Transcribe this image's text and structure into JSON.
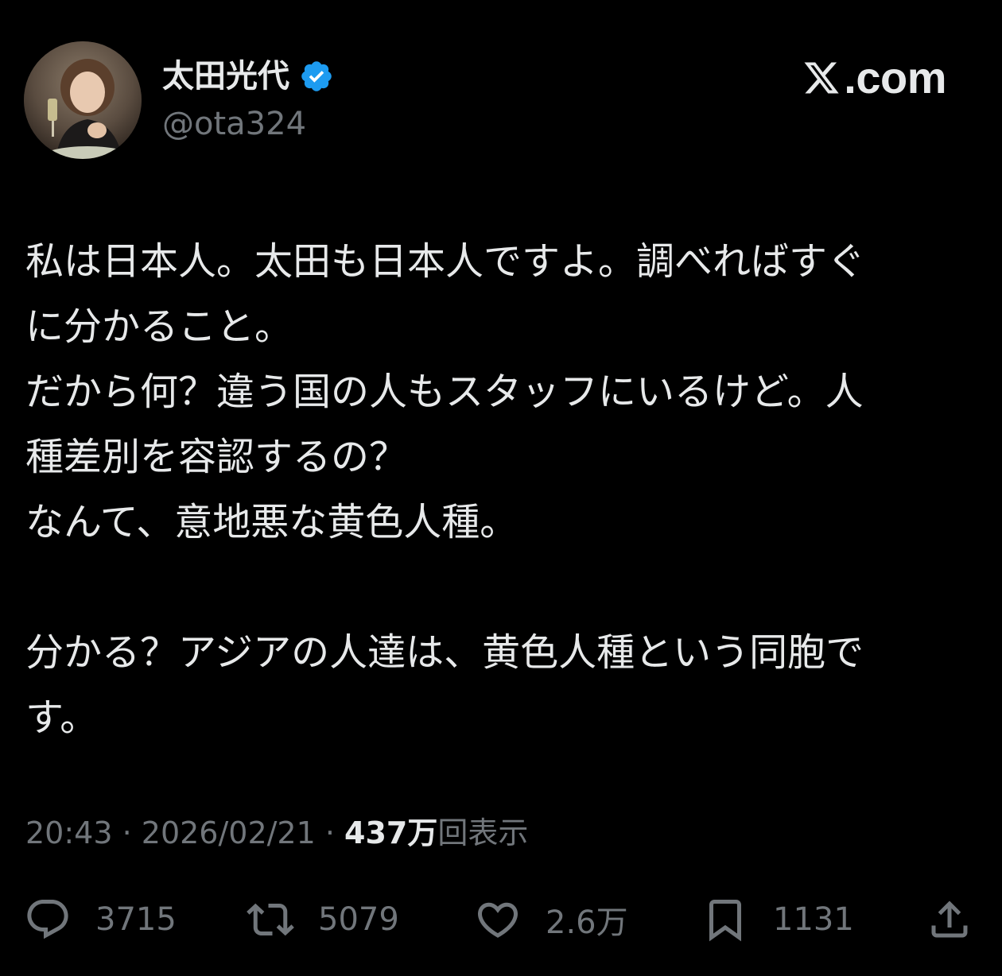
{
  "header": {
    "display_name": "太田光代",
    "handle": "@ota324",
    "brand": "X.com",
    "brand_suffix": ".com"
  },
  "tweet": {
    "paragraphs": [
      "私は日本人。太田も日本人ですよ。調べればすぐ\nに分かること。\nだから何？違う国の人もスタッフにいるけど。人\n種差別を容認するの？\nなんて、意地悪な黄色人種。",
      "分かる？アジアの人達は、黄色人種という同胞で\nす。"
    ]
  },
  "meta": {
    "time": "20:43",
    "separator": " · ",
    "date": "2026/02/21",
    "views_count": "437万",
    "views_label": "回表示"
  },
  "actions": {
    "replies": "3715",
    "reposts": "5079",
    "likes": "2.6万",
    "bookmarks": "1131"
  },
  "icons": {
    "verified": "verified-badge-icon",
    "reply": "reply-icon",
    "repost": "repost-icon",
    "like": "heart-icon",
    "bookmark": "bookmark-icon",
    "share": "share-icon"
  },
  "colors": {
    "background": "#000000",
    "text_primary": "#e7e9ea",
    "text_secondary": "#71767b",
    "verified_blue": "#1d9bf0"
  }
}
